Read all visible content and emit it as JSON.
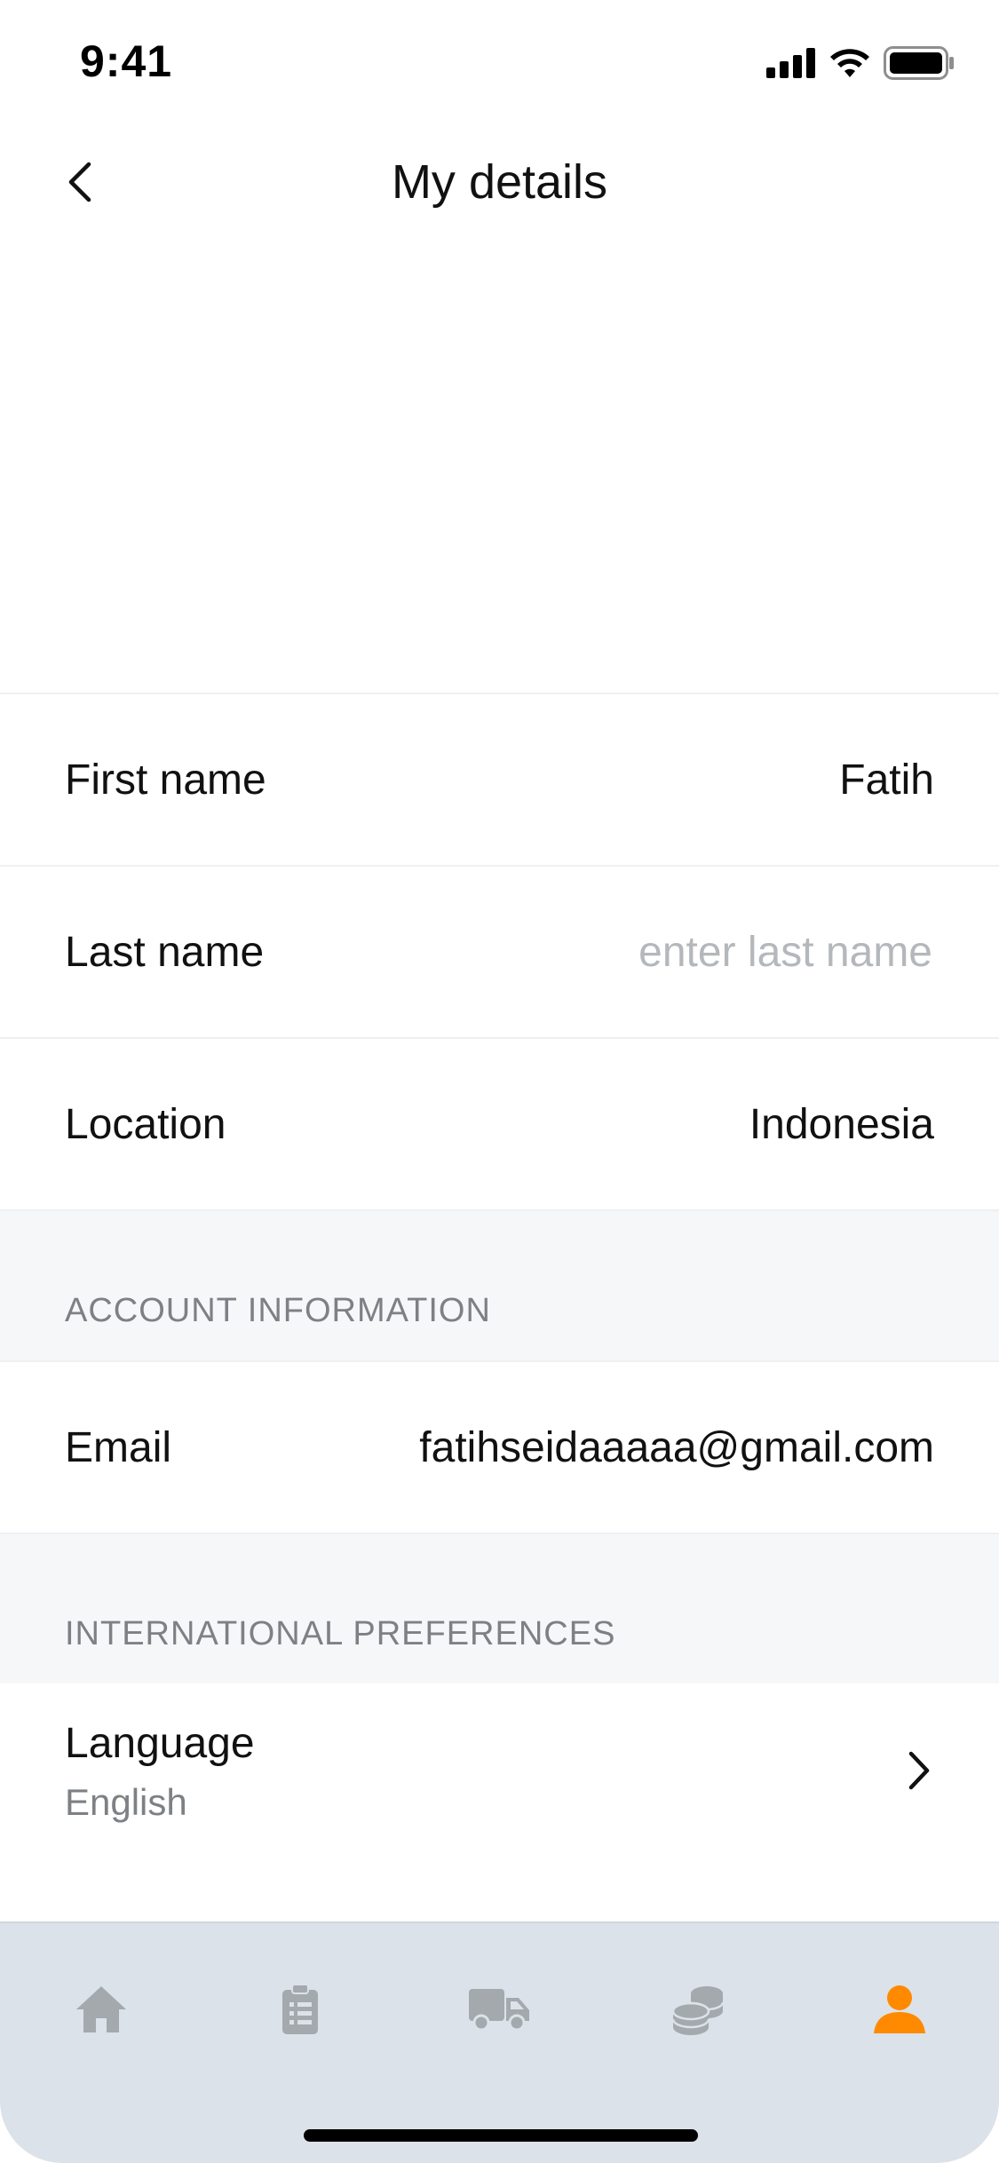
{
  "status_bar": {
    "time": "9:41"
  },
  "header": {
    "title": "My details",
    "back_icon": "chevron-left-icon"
  },
  "profile_form": {
    "first_name": {
      "label": "First name",
      "value": "Fatih"
    },
    "last_name": {
      "label": "Last name",
      "value": "",
      "placeholder": "enter last name"
    },
    "location": {
      "label": "Location",
      "value": "Indonesia"
    }
  },
  "account_section": {
    "title": "ACCOUNT INFORMATION",
    "email": {
      "label": "Email",
      "value": "fatihseidaaaaa@gmail.com"
    }
  },
  "international_section": {
    "title": "INTERNATIONAL PREFERENCES",
    "language": {
      "label": "Language",
      "value": "English"
    }
  },
  "tab_bar": {
    "items": [
      {
        "icon": "home-icon",
        "active": false
      },
      {
        "icon": "clipboard-icon",
        "active": false
      },
      {
        "icon": "truck-icon",
        "active": false
      },
      {
        "icon": "coins-icon",
        "active": false
      },
      {
        "icon": "user-icon",
        "active": true
      }
    ],
    "active_color": "#FF8A00",
    "inactive_color": "#A4A9AE"
  }
}
